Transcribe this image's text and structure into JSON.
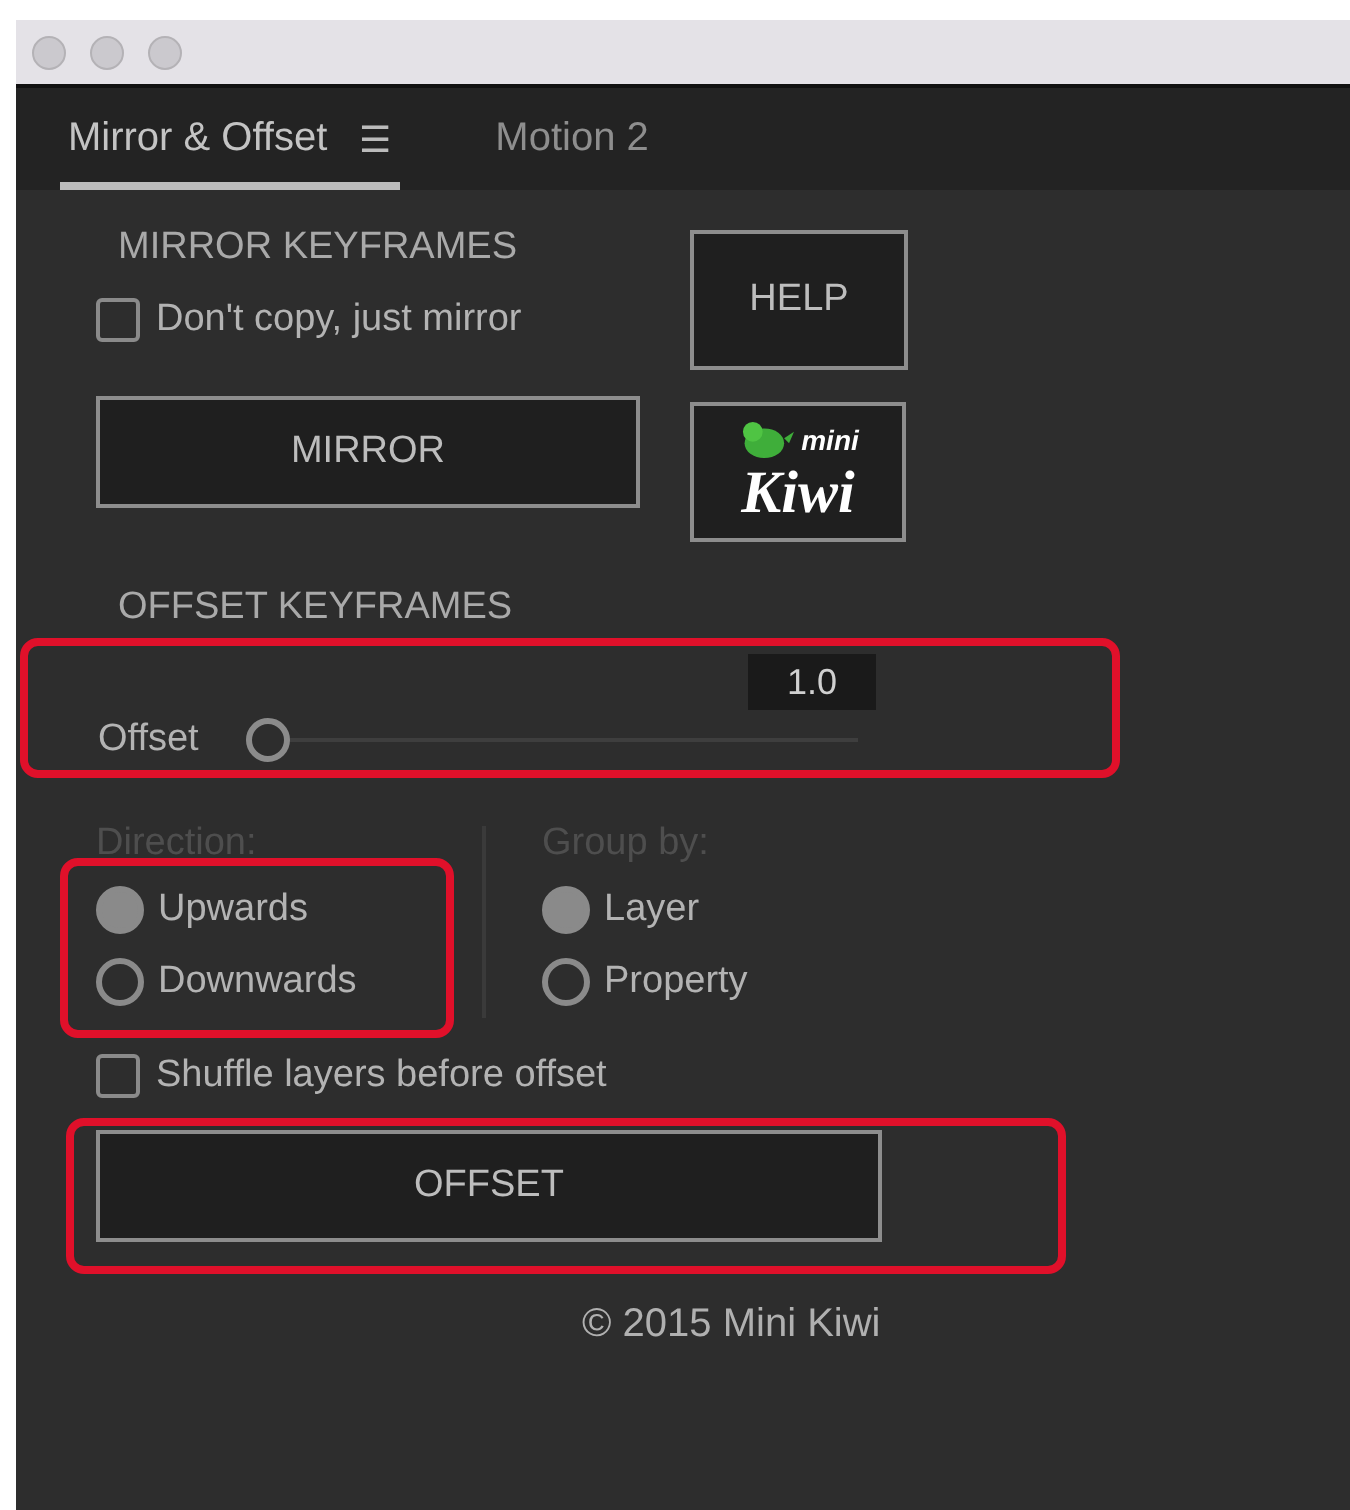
{
  "tabs": [
    {
      "label": "Mirror & Offset",
      "selected": true,
      "menu_icon": "☰"
    },
    {
      "label": "Motion 2",
      "selected": false
    }
  ],
  "mirror": {
    "heading": "MIRROR KEYFRAMES",
    "checkbox": {
      "label": "Don't copy, just mirror",
      "checked": false
    },
    "mirror_button": "MIRROR",
    "help_button": "HELP",
    "logo": {
      "small": "mini",
      "large": "Kiwi"
    }
  },
  "offset": {
    "heading": "OFFSET KEYFRAMES",
    "slider": {
      "label": "Offset",
      "value": "1.0",
      "level": 0,
      "highlighted": true
    },
    "direction": {
      "label": "Direction:",
      "highlighted": true,
      "options": [
        {
          "label": "Upwards",
          "selected": true
        },
        {
          "label": "Downwards",
          "selected": false
        }
      ]
    },
    "group_by": {
      "label": "Group by:",
      "options": [
        {
          "label": "Layer",
          "selected": true
        },
        {
          "label": "Property",
          "selected": false
        }
      ]
    },
    "shuffle": {
      "label": "Shuffle layers before offset",
      "checked": false
    },
    "offset_button": {
      "label": "OFFSET",
      "highlighted": true
    }
  },
  "footer": "© 2015 Mini Kiwi"
}
